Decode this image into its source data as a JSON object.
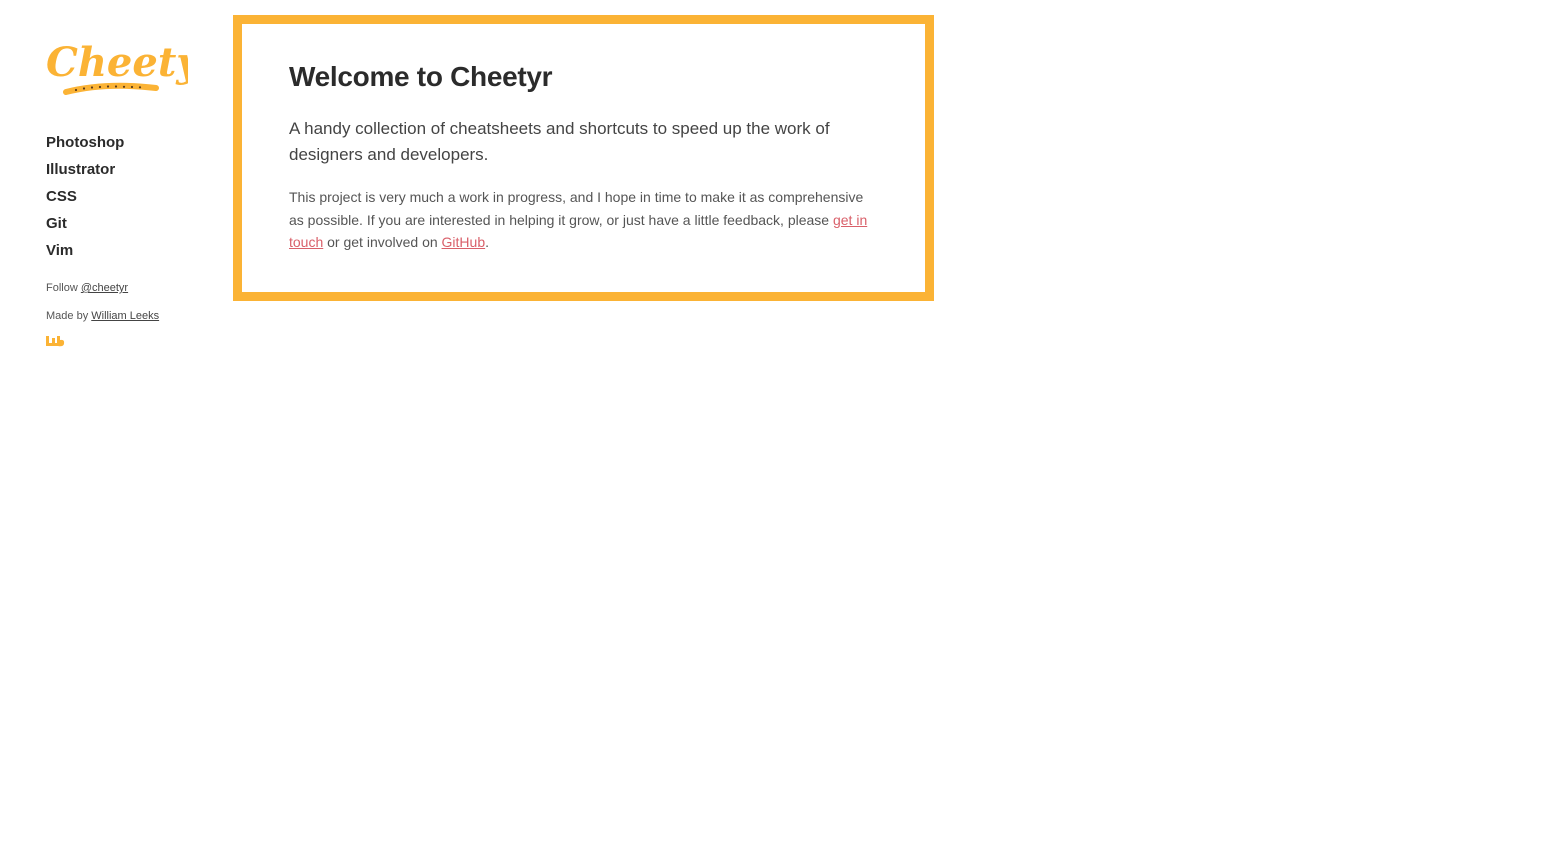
{
  "brand": {
    "logo_text": "Cheetyr",
    "accent_color": "#fbb335",
    "link_color": "#d9606a"
  },
  "nav": {
    "items": [
      {
        "label": "Photoshop"
      },
      {
        "label": "Illustrator"
      },
      {
        "label": "CSS"
      },
      {
        "label": "Git"
      },
      {
        "label": "Vim"
      }
    ]
  },
  "meta": {
    "follow_prefix": "Follow ",
    "follow_link": "@cheetyr",
    "made_prefix": "Made by ",
    "made_link": "William Leeks",
    "maker_icon": "wl-mark-icon"
  },
  "main": {
    "title": "Welcome to Cheetyr",
    "lead": "A handy collection of cheatsheets and shortcuts to speed up the work of designers and developers.",
    "body_prefix": "This project is very much a work in progress, and I hope in time to make it as comprehensive as possible. If you are interested in helping it grow, or just have a little feedback, please ",
    "contact_link": "get in touch",
    "body_middle": " or get involved on ",
    "github_link": "GitHub",
    "body_suffix": "."
  }
}
